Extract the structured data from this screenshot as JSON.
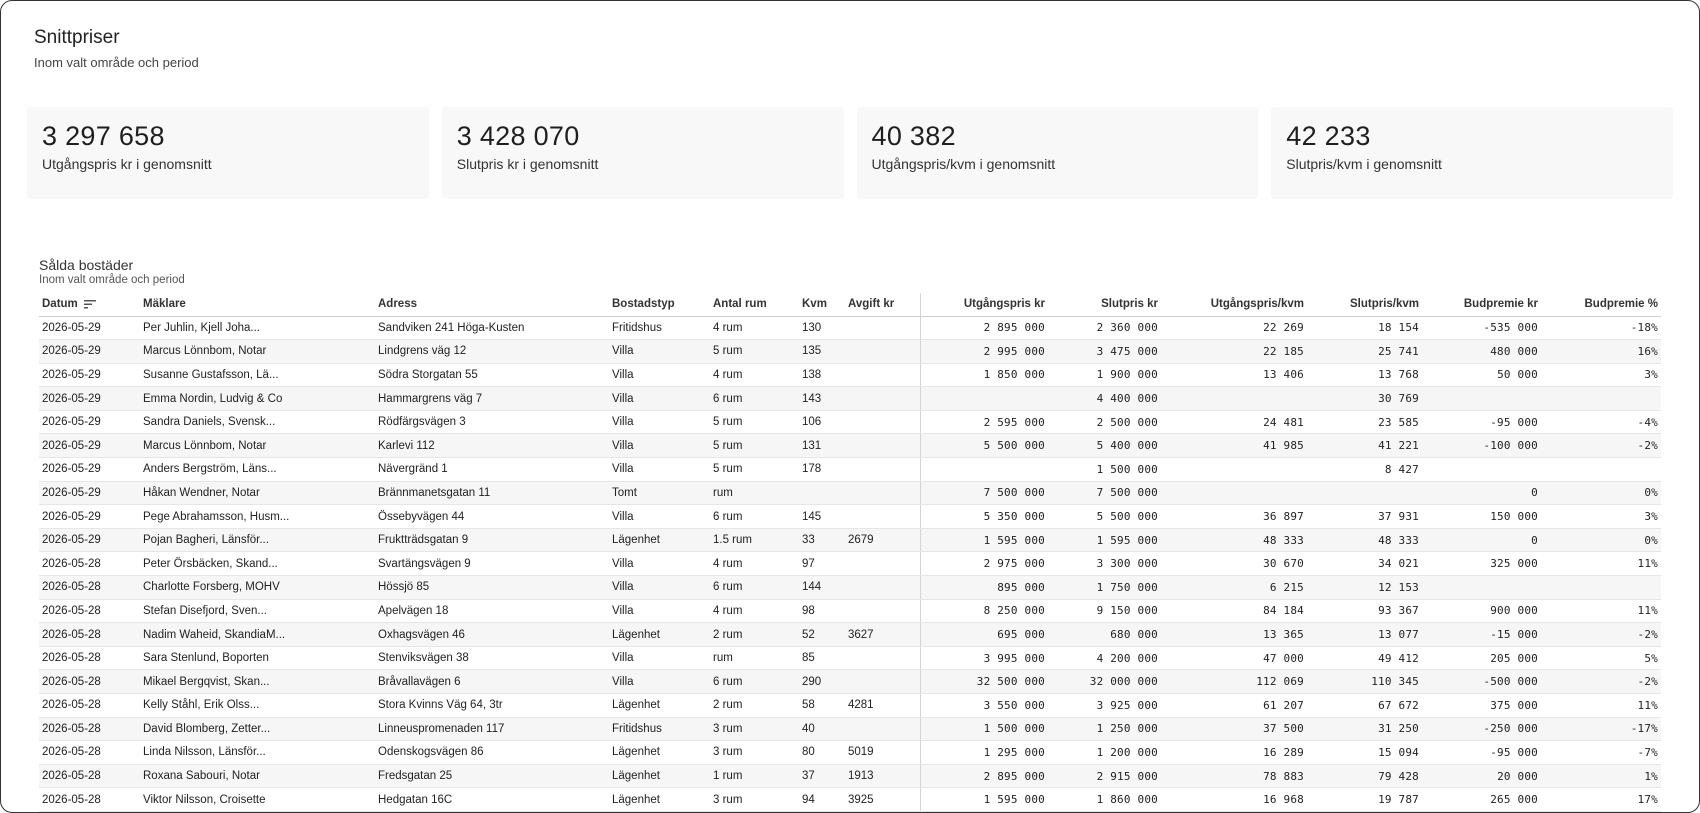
{
  "header": {
    "title": "Snittpriser",
    "subtitle": "Inom valt område och period"
  },
  "kpis": [
    {
      "value": "3 297 658",
      "label": "Utgångspris kr i genomsnitt"
    },
    {
      "value": "3 428 070",
      "label": "Slutpris kr i genomsnitt"
    },
    {
      "value": "40 382",
      "label": "Utgångspris/kvm i genomsnitt"
    },
    {
      "value": "42 233",
      "label": "Slutpris/kvm i genomsnitt"
    }
  ],
  "table": {
    "title": "Sålda bostäder",
    "subtitle": "Inom valt område och period",
    "sort_icon": "sort-lines-icon",
    "columns": [
      "Datum",
      "Mäklare",
      "Adress",
      "Bostadstyp",
      "Antal rum",
      "Kvm",
      "Avgift kr",
      "Utgångspris kr",
      "Slutpris kr",
      "Utgångspris/kvm",
      "Slutpris/kvm",
      "Budpremie kr",
      "Budpremie %"
    ],
    "rows": [
      [
        "2026-05-29",
        "Per Juhlin, Kjell Joha...",
        "Sandviken 241 Höga-Kusten",
        "Fritidshus",
        "4 rum",
        "130",
        "",
        "2 895 000",
        "2 360 000",
        "22 269",
        "18 154",
        "-535 000",
        "-18%"
      ],
      [
        "2026-05-29",
        "Marcus Lönnbom, Notar",
        "Lindgrens väg 12",
        "Villa",
        "5 rum",
        "135",
        "",
        "2 995 000",
        "3 475 000",
        "22 185",
        "25 741",
        "480 000",
        "16%"
      ],
      [
        "2026-05-29",
        "Susanne Gustafsson, Lä...",
        "Södra Storgatan 55",
        "Villa",
        "4 rum",
        "138",
        "",
        "1 850 000",
        "1 900 000",
        "13 406",
        "13 768",
        "50 000",
        "3%"
      ],
      [
        "2026-05-29",
        "Emma Nordin, Ludvig & Co",
        "Hammargrens väg 7",
        "Villa",
        "6 rum",
        "143",
        "",
        "",
        "4 400 000",
        "",
        "30 769",
        "",
        ""
      ],
      [
        "2026-05-29",
        "Sandra Daniels, Svensk...",
        "Rödfärgsvägen 3",
        "Villa",
        "5 rum",
        "106",
        "",
        "2 595 000",
        "2 500 000",
        "24 481",
        "23 585",
        "-95 000",
        "-4%"
      ],
      [
        "2026-05-29",
        "Marcus Lönnbom, Notar",
        "Karlevi 112",
        "Villa",
        "5 rum",
        "131",
        "",
        "5 500 000",
        "5 400 000",
        "41 985",
        "41 221",
        "-100 000",
        "-2%"
      ],
      [
        "2026-05-29",
        "Anders Bergström, Läns...",
        "Nävergränd 1",
        "Villa",
        "5 rum",
        "178",
        "",
        "",
        "1 500 000",
        "",
        "8 427",
        "",
        ""
      ],
      [
        "2026-05-29",
        "Håkan Wendner, Notar",
        "Brännmanetsgatan 11",
        "Tomt",
        "rum",
        "",
        "",
        "7 500 000",
        "7 500 000",
        "",
        "",
        "0",
        "0%"
      ],
      [
        "2026-05-29",
        "Pege Abrahamsson, Husm...",
        "Össebyvägen 44",
        "Villa",
        "6 rum",
        "145",
        "",
        "5 350 000",
        "5 500 000",
        "36 897",
        "37 931",
        "150 000",
        "3%"
      ],
      [
        "2026-05-29",
        "Pojan Bagheri, Länsför...",
        "Fruktträdsgatan 9",
        "Lägenhet",
        "1.5 rum",
        "33",
        "2679",
        "1 595 000",
        "1 595 000",
        "48 333",
        "48 333",
        "0",
        "0%"
      ],
      [
        "2026-05-28",
        "Peter Örsbäcken, Skand...",
        "Svartängsvägen 9",
        "Villa",
        "4 rum",
        "97",
        "",
        "2 975 000",
        "3 300 000",
        "30 670",
        "34 021",
        "325 000",
        "11%"
      ],
      [
        "2026-05-28",
        "Charlotte Forsberg, MOHV",
        "Hössjö 85",
        "Villa",
        "6 rum",
        "144",
        "",
        "895 000",
        "1 750 000",
        "6 215",
        "12 153",
        "",
        ""
      ],
      [
        "2026-05-28",
        "Stefan Disefjord, Sven...",
        "Apelvägen 18",
        "Villa",
        "4 rum",
        "98",
        "",
        "8 250 000",
        "9 150 000",
        "84 184",
        "93 367",
        "900 000",
        "11%"
      ],
      [
        "2026-05-28",
        "Nadim Waheid, SkandiaM...",
        "Oxhagsvägen 46",
        "Lägenhet",
        "2 rum",
        "52",
        "3627",
        "695 000",
        "680 000",
        "13 365",
        "13 077",
        "-15 000",
        "-2%"
      ],
      [
        "2026-05-28",
        "Sara Stenlund, Boporten",
        "Stenviksvägen 38",
        "Villa",
        "rum",
        "85",
        "",
        "3 995 000",
        "4 200 000",
        "47 000",
        "49 412",
        "205 000",
        "5%"
      ],
      [
        "2026-05-28",
        "Mikael Bergqvist, Skan...",
        "Bråvallavägen 6",
        "Villa",
        "6 rum",
        "290",
        "",
        "32 500 000",
        "32 000 000",
        "112 069",
        "110 345",
        "-500 000",
        "-2%"
      ],
      [
        "2026-05-28",
        "Kelly Ståhl, Erik Olss...",
        "Stora Kvinns Väg 64, 3tr",
        "Lägenhet",
        "2 rum",
        "58",
        "4281",
        "3 550 000",
        "3 925 000",
        "61 207",
        "67 672",
        "375 000",
        "11%"
      ],
      [
        "2026-05-28",
        "David Blomberg, Zetter...",
        "Linneuspromenaden 117",
        "Fritidshus",
        "3 rum",
        "40",
        "",
        "1 500 000",
        "1 250 000",
        "37 500",
        "31 250",
        "-250 000",
        "-17%"
      ],
      [
        "2026-05-28",
        "Linda Nilsson, Länsför...",
        "Odenskogsvägen 86",
        "Lägenhet",
        "3 rum",
        "80",
        "5019",
        "1 295 000",
        "1 200 000",
        "16 289",
        "15 094",
        "-95 000",
        "-7%"
      ],
      [
        "2026-05-28",
        "Roxana Sabouri, Notar",
        "Fredsgatan 25",
        "Lägenhet",
        "1 rum",
        "37",
        "1913",
        "2 895 000",
        "2 915 000",
        "78 883",
        "79 428",
        "20 000",
        "1%"
      ],
      [
        "2026-05-28",
        "Viktor Nilsson, Croisette",
        "Hedgatan 16C",
        "Lägenhet",
        "3 rum",
        "94",
        "3925",
        "1 595 000",
        "1 860 000",
        "16 968",
        "19 787",
        "265 000",
        "17%"
      ]
    ]
  }
}
